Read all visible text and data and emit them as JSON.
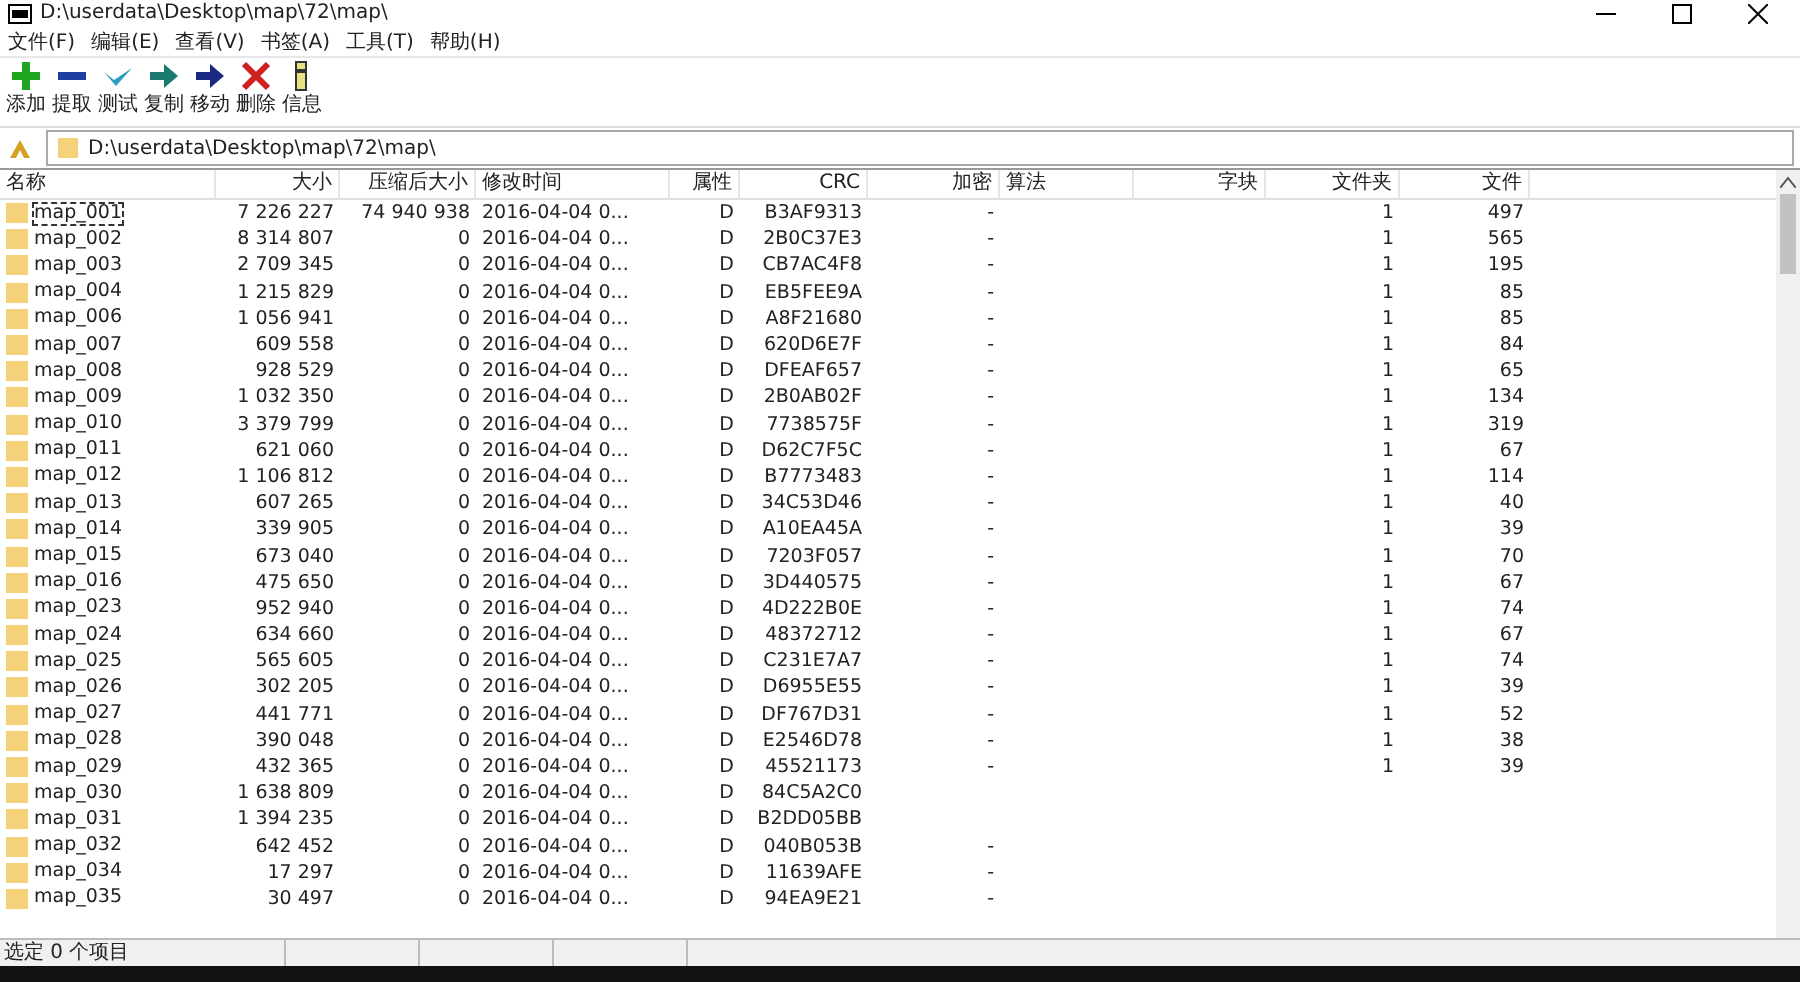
{
  "window": {
    "title": "D:\\userdata\\Desktop\\map\\72\\map\\"
  },
  "menu": [
    "文件(F)",
    "编辑(E)",
    "查看(V)",
    "书签(A)",
    "工具(T)",
    "帮助(H)"
  ],
  "toolbar": [
    {
      "kind": "add",
      "label": "添加"
    },
    {
      "kind": "extract",
      "label": "提取"
    },
    {
      "kind": "test",
      "label": "测试"
    },
    {
      "kind": "copy",
      "label": "复制"
    },
    {
      "kind": "move",
      "label": "移动"
    },
    {
      "kind": "delete",
      "label": "删除"
    },
    {
      "kind": "info",
      "label": "信息"
    }
  ],
  "address": {
    "value": "D:\\userdata\\Desktop\\map\\72\\map\\"
  },
  "table": {
    "columns": [
      "名称",
      "大小",
      "压缩后大小",
      "修改时间",
      "属性",
      "CRC",
      "加密",
      "算法",
      "字块",
      "文件夹",
      "文件"
    ],
    "rows": [
      {
        "name": "map_001",
        "size": "7 226 227",
        "packed": "74 940 938",
        "modified": "2016-04-04 0...",
        "attr": "D",
        "crc": "B3AF9313",
        "encrypted": "-",
        "folders": "1",
        "files": "497",
        "focused": true
      },
      {
        "name": "map_002",
        "size": "8 314 807",
        "packed": "0",
        "modified": "2016-04-04 0...",
        "attr": "D",
        "crc": "2B0C37E3",
        "encrypted": "-",
        "folders": "1",
        "files": "565",
        "focused": false
      },
      {
        "name": "map_003",
        "size": "2 709 345",
        "packed": "0",
        "modified": "2016-04-04 0...",
        "attr": "D",
        "crc": "CB7AC4F8",
        "encrypted": "-",
        "folders": "1",
        "files": "195",
        "focused": false
      },
      {
        "name": "map_004",
        "size": "1 215 829",
        "packed": "0",
        "modified": "2016-04-04 0...",
        "attr": "D",
        "crc": "EB5FEE9A",
        "encrypted": "-",
        "folders": "1",
        "files": "85",
        "focused": false
      },
      {
        "name": "map_006",
        "size": "1 056 941",
        "packed": "0",
        "modified": "2016-04-04 0...",
        "attr": "D",
        "crc": "A8F21680",
        "encrypted": "-",
        "folders": "1",
        "files": "85",
        "focused": false
      },
      {
        "name": "map_007",
        "size": "609 558",
        "packed": "0",
        "modified": "2016-04-04 0...",
        "attr": "D",
        "crc": "620D6E7F",
        "encrypted": "-",
        "folders": "1",
        "files": "84",
        "focused": false
      },
      {
        "name": "map_008",
        "size": "928 529",
        "packed": "0",
        "modified": "2016-04-04 0...",
        "attr": "D",
        "crc": "DFEAF657",
        "encrypted": "-",
        "folders": "1",
        "files": "65",
        "focused": false
      },
      {
        "name": "map_009",
        "size": "1 032 350",
        "packed": "0",
        "modified": "2016-04-04 0...",
        "attr": "D",
        "crc": "2B0AB02F",
        "encrypted": "-",
        "folders": "1",
        "files": "134",
        "focused": false
      },
      {
        "name": "map_010",
        "size": "3 379 799",
        "packed": "0",
        "modified": "2016-04-04 0...",
        "attr": "D",
        "crc": "7738575F",
        "encrypted": "-",
        "folders": "1",
        "files": "319",
        "focused": false
      },
      {
        "name": "map_011",
        "size": "621 060",
        "packed": "0",
        "modified": "2016-04-04 0...",
        "attr": "D",
        "crc": "D62C7F5C",
        "encrypted": "-",
        "folders": "1",
        "files": "67",
        "focused": false
      },
      {
        "name": "map_012",
        "size": "1 106 812",
        "packed": "0",
        "modified": "2016-04-04 0...",
        "attr": "D",
        "crc": "B7773483",
        "encrypted": "-",
        "folders": "1",
        "files": "114",
        "focused": false
      },
      {
        "name": "map_013",
        "size": "607 265",
        "packed": "0",
        "modified": "2016-04-04 0...",
        "attr": "D",
        "crc": "34C53D46",
        "encrypted": "-",
        "folders": "1",
        "files": "40",
        "focused": false
      },
      {
        "name": "map_014",
        "size": "339 905",
        "packed": "0",
        "modified": "2016-04-04 0...",
        "attr": "D",
        "crc": "A10EA45A",
        "encrypted": "-",
        "folders": "1",
        "files": "39",
        "focused": false
      },
      {
        "name": "map_015",
        "size": "673 040",
        "packed": "0",
        "modified": "2016-04-04 0...",
        "attr": "D",
        "crc": "7203F057",
        "encrypted": "-",
        "folders": "1",
        "files": "70",
        "focused": false
      },
      {
        "name": "map_016",
        "size": "475 650",
        "packed": "0",
        "modified": "2016-04-04 0...",
        "attr": "D",
        "crc": "3D440575",
        "encrypted": "-",
        "folders": "1",
        "files": "67",
        "focused": false
      },
      {
        "name": "map_023",
        "size": "952 940",
        "packed": "0",
        "modified": "2016-04-04 0...",
        "attr": "D",
        "crc": "4D222B0E",
        "encrypted": "-",
        "folders": "1",
        "files": "74",
        "focused": false
      },
      {
        "name": "map_024",
        "size": "634 660",
        "packed": "0",
        "modified": "2016-04-04 0...",
        "attr": "D",
        "crc": "48372712",
        "encrypted": "-",
        "folders": "1",
        "files": "67",
        "focused": false
      },
      {
        "name": "map_025",
        "size": "565 605",
        "packed": "0",
        "modified": "2016-04-04 0...",
        "attr": "D",
        "crc": "C231E7A7",
        "encrypted": "-",
        "folders": "1",
        "files": "74",
        "focused": false
      },
      {
        "name": "map_026",
        "size": "302 205",
        "packed": "0",
        "modified": "2016-04-04 0...",
        "attr": "D",
        "crc": "D6955E55",
        "encrypted": "-",
        "folders": "1",
        "files": "39",
        "focused": false
      },
      {
        "name": "map_027",
        "size": "441 771",
        "packed": "0",
        "modified": "2016-04-04 0...",
        "attr": "D",
        "crc": "DF767D31",
        "encrypted": "-",
        "folders": "1",
        "files": "52",
        "focused": false
      },
      {
        "name": "map_028",
        "size": "390 048",
        "packed": "0",
        "modified": "2016-04-04 0...",
        "attr": "D",
        "crc": "E2546D78",
        "encrypted": "-",
        "folders": "1",
        "files": "38",
        "focused": false
      },
      {
        "name": "map_029",
        "size": "432 365",
        "packed": "0",
        "modified": "2016-04-04 0...",
        "attr": "D",
        "crc": "45521173",
        "encrypted": "-",
        "folders": "1",
        "files": "39",
        "focused": false
      },
      {
        "name": "map_030",
        "size": "1 638 809",
        "packed": "0",
        "modified": "2016-04-04 0...",
        "attr": "D",
        "crc": "84C5A2C0",
        "focused": false
      },
      {
        "name": "map_031",
        "size": "1 394 235",
        "packed": "0",
        "modified": "2016-04-04 0...",
        "attr": "D",
        "crc": "B2DD05BB",
        "focused": false
      },
      {
        "name": "map_032",
        "size": "642 452",
        "packed": "0",
        "modified": "2016-04-04 0...",
        "attr": "D",
        "crc": "040B053B",
        "encrypted": "-",
        "focused": false
      },
      {
        "name": "map_034",
        "size": "17 297",
        "packed": "0",
        "modified": "2016-04-04 0...",
        "attr": "D",
        "crc": "11639AFE",
        "encrypted": "-",
        "focused": false
      },
      {
        "name": "map_035",
        "size": "30 497",
        "packed": "0",
        "modified": "2016-04-04 0...",
        "attr": "D",
        "crc": "94EA9E21",
        "encrypted": "-",
        "focused": false
      }
    ]
  },
  "status_bar": {
    "text": "选定 0 个项目"
  }
}
